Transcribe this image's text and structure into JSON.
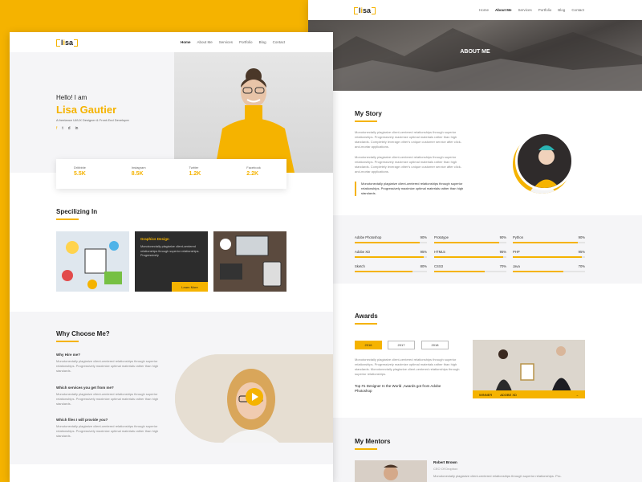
{
  "back_page": {
    "nav": {
      "logo": {
        "prefix": "l",
        "highlight": "i",
        "suffix": "sa"
      },
      "items": [
        "Home",
        "About Me",
        "Services",
        "Portfolio",
        "Blog",
        "Contact"
      ],
      "active": "About Me"
    },
    "banner_title": "ABOUT ME",
    "story": {
      "title": "My Story",
      "p1": "Monotonectally plagiarize client-centered relationships through superior relationships. Progressively maximize optimal materials rather than high standards. Completely leverage other's unique customer service after click-and-mortar applications.",
      "p2": "Monotonectally plagiarize client-centered relationships through superior relationships. Progressively maximize optimal materials rather than high standards. Completely leverage other's unique customer service after click-and-mortar applications.",
      "quote": "Monotonectally plagiarize client-centered relationships through superior relationships. Progressively maximize optimal materials rather than high standards."
    },
    "skills": [
      {
        "name": "Adobe Photoshop",
        "pct": 90
      },
      {
        "name": "Adobe XD",
        "pct": 95
      },
      {
        "name": "Sketch",
        "pct": 80
      },
      {
        "name": "Prototype",
        "pct": 90
      },
      {
        "name": "HTML5",
        "pct": 95
      },
      {
        "name": "CSS3",
        "pct": 70
      },
      {
        "name": "Python",
        "pct": 90
      },
      {
        "name": "PHP",
        "pct": 95
      },
      {
        "name": "Java",
        "pct": 70
      }
    ],
    "awards": {
      "title": "Awards",
      "years": [
        "2016",
        "2017",
        "2018"
      ],
      "active_year": "2016",
      "text": "Monotonectally plagiarize client-centered relationships through superior relationships. Progressively maximize optimal materials rather than high standards. Monotonectally plagiarize client-centered relationships through superior relationships.",
      "highlight": "Top #1 Designer In the World ,Awards got from Adobe Photoshop",
      "badge_label": "WINNER",
      "badge_value": "ADOBE XD"
    },
    "mentors": {
      "title": "My Mentors",
      "name": "Robert Brown",
      "role": "CEO Of Dropbox",
      "text": "Monotonectally plagiarize client-centered relationships through superior relationships. Pro-"
    }
  },
  "front_page": {
    "nav": {
      "logo": {
        "prefix": "l",
        "highlight": "i",
        "suffix": "sa"
      },
      "items": [
        "Home",
        "About Me",
        "Services",
        "Portfolio",
        "Blog",
        "Contact"
      ],
      "active": "Home"
    },
    "hero": {
      "greeting": "Hello! I am",
      "name": "Lisa Gautier",
      "subtitle": "A freelance UI/UX Designer & Front-End Developer",
      "socials": [
        "f",
        "t",
        "d",
        "in"
      ]
    },
    "stats": [
      {
        "label": "Dribbble",
        "value": "5.5K"
      },
      {
        "label": "Instagram",
        "value": "8.5K"
      },
      {
        "label": "Twitter",
        "value": "1.2K"
      },
      {
        "label": "Facebook",
        "value": "2.2K"
      }
    ],
    "specializing": {
      "title": "Specilizing In",
      "cards": [
        {
          "title": "",
          "text": ""
        },
        {
          "title": "Graphics Design",
          "text": "Monotonectally plagiarize client-centered relationships through superior relationships. Progressively",
          "button": "Learn More"
        },
        {
          "title": "",
          "text": ""
        }
      ]
    },
    "why": {
      "title": "Why Choose Me?",
      "items": [
        {
          "q": "Why Hire me?",
          "a": "Monotonectally plagiarize client-centered relationships through superior relationships. Progressively maximize optimal materials rather than high standards."
        },
        {
          "q": "Which services you get from me?",
          "a": "Monotonectally plagiarize client-centered relationships through superior relationships. Progressively maximize optimal materials rather than high standards."
        },
        {
          "q": "Which files I will provide you?",
          "a": "Monotonectally plagiarize client-centered relationships through superior relationships. Progressively maximize optimal materials rather than high standards."
        }
      ]
    }
  }
}
